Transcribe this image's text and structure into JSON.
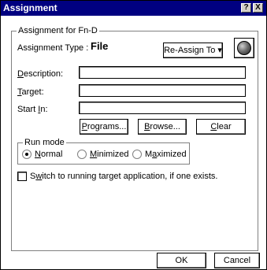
{
  "window": {
    "title": "Assignment",
    "help_glyph": "?",
    "close_glyph": "X"
  },
  "group": {
    "title": "Assignment for Fn-D",
    "type_label": "Assignment Type :",
    "type_value": "File",
    "reassign_label": "Re-Assign To ▾"
  },
  "fields": {
    "description": {
      "label_ul": "D",
      "label_rest": "escription:",
      "value": ""
    },
    "target": {
      "label_ul": "T",
      "label_rest": "arget:",
      "value": ""
    },
    "start_in": {
      "label_pre": "Start ",
      "label_ul": "I",
      "label_rest": "n:",
      "value": ""
    }
  },
  "buttons": {
    "programs": {
      "ul": "P",
      "rest": "rograms..."
    },
    "browse": {
      "ul": "B",
      "rest": "rowse..."
    },
    "clear": {
      "ul": "C",
      "rest": "lear"
    },
    "ok": "OK",
    "cancel": "Cancel"
  },
  "run_mode": {
    "title": "Run mode",
    "options": [
      {
        "ul": "N",
        "rest": "ormal",
        "checked": true
      },
      {
        "ul": "M",
        "rest": "inimized",
        "checked": false
      },
      {
        "pre": "M",
        "ul": "a",
        "rest": "ximized",
        "checked": false
      }
    ]
  },
  "switch_option": {
    "pre": "S",
    "ul": "w",
    "rest": "itch to running target application, if one exists.",
    "checked": false
  }
}
